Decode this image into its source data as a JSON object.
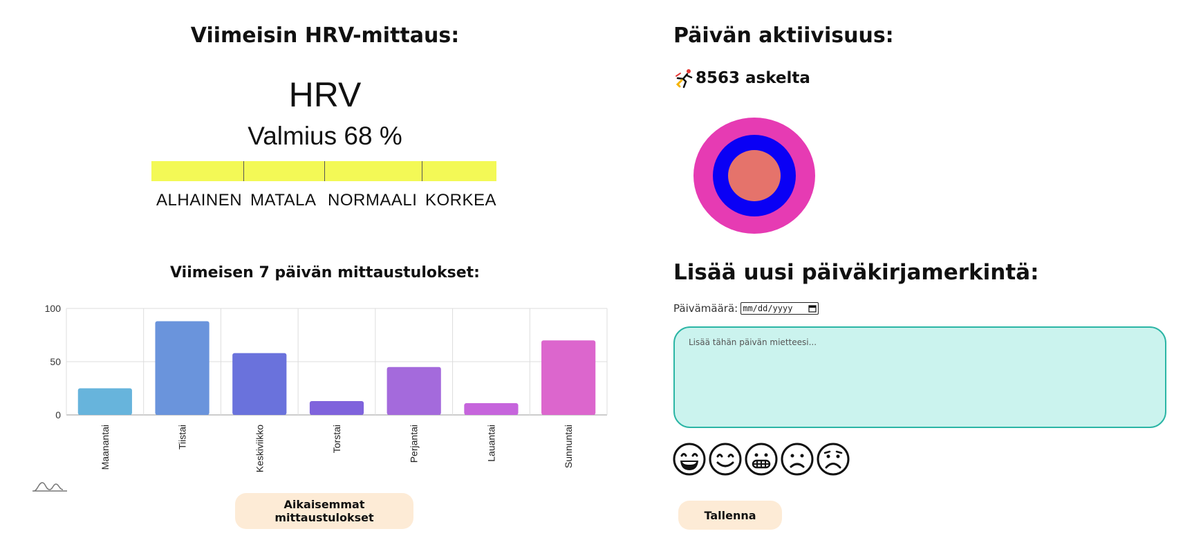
{
  "hrv": {
    "section_title": "Viimeisin HRV-mittaus:",
    "big_label": "HRV",
    "readiness_text": "Valmius 68 %",
    "readiness_percent": 68,
    "bar_color": "#f3f956",
    "levels": [
      "ALHAINEN",
      "MATALA",
      "NORMAALI",
      "KORKEA"
    ]
  },
  "chart_title": "Viimeisen 7 päivän mittaustulokset:",
  "chart_data": {
    "type": "bar",
    "categories": [
      "Maanantai",
      "Tiistai",
      "Keskiviikko",
      "Torstai",
      "Perjantai",
      "Lauantai",
      "Sunnuntai"
    ],
    "values": [
      25,
      88,
      58,
      13,
      45,
      11,
      70
    ],
    "colors": [
      "#67b4dc",
      "#6a94dc",
      "#6a72dc",
      "#7f63dc",
      "#a46adc",
      "#c665dc",
      "#dc66cd"
    ],
    "ylim": [
      0,
      100
    ],
    "yticks": [
      "0",
      "50",
      "100"
    ],
    "grid": true
  },
  "history_button": "Aikaisemmat mittaustulokset",
  "activity": {
    "section_title": "Päivän aktiivisuus:",
    "steps_text": "8563 askelta",
    "ring_colors": [
      "#e63bb3",
      "#0a00f5",
      "#e5736b"
    ]
  },
  "diary": {
    "section_title": "Lisää uusi päiväkirjamerkintä:",
    "date_label": "Päivämäärä:",
    "date_placeholder": "mm/dd/yyyy",
    "textarea_placeholder": "Lisää tähän päivän mietteesi...",
    "moods": [
      "very-happy",
      "happy",
      "grimace",
      "sad",
      "very-sad"
    ],
    "save_button": "Tallenna"
  }
}
